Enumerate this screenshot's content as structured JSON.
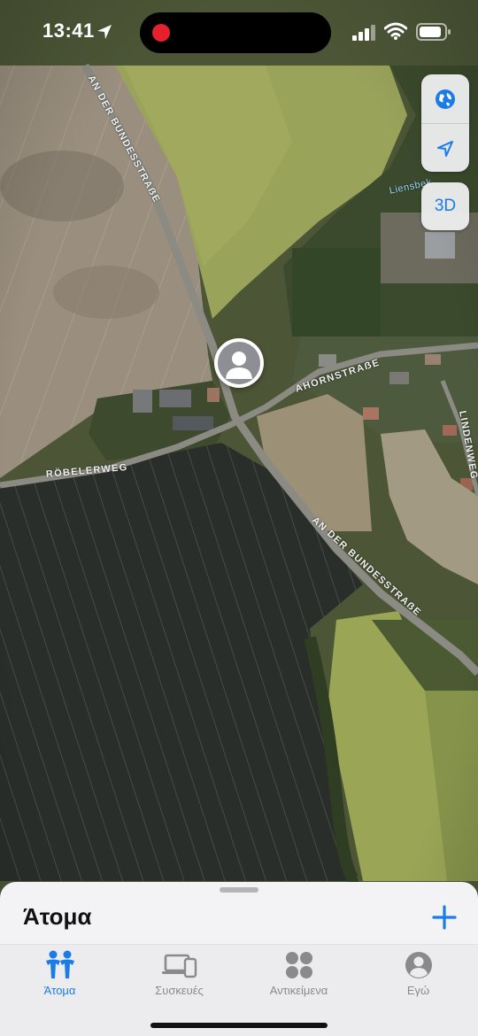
{
  "status": {
    "time": "13:41"
  },
  "map": {
    "streets": [
      "AN DER BUNDESSTRAẞE",
      "AHORNSTRAẞE",
      "RÖBELERWEG",
      "LINDENWEG",
      "AN DER BUNDESSTRAẞE"
    ],
    "water": "Liensbek",
    "mode_3d": "3D"
  },
  "sheet": {
    "title": "Άτομα"
  },
  "tabs": [
    {
      "label": "Άτομα",
      "icon": "people-icon",
      "active": true
    },
    {
      "label": "Συσκευές",
      "icon": "devices-icon",
      "active": false
    },
    {
      "label": "Αντικείμενα",
      "icon": "items-icon",
      "active": false
    },
    {
      "label": "Εγώ",
      "icon": "me-icon",
      "active": false
    }
  ],
  "colors": {
    "accent": "#1a7ce6",
    "inactive": "#8a8a8e",
    "record": "#e5222b"
  }
}
